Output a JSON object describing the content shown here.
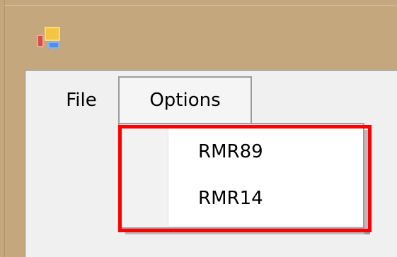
{
  "window": {
    "icon": "application-icon"
  },
  "menubar": {
    "items": [
      {
        "label": "File"
      },
      {
        "label": "Options"
      }
    ]
  },
  "dropdown": {
    "items": [
      {
        "label": "RMR89"
      },
      {
        "label": "RMR14"
      }
    ]
  },
  "annotation": {
    "highlight_color": "#ff0000"
  },
  "colors": {
    "desktop": "#c4a77c",
    "client_background": "#f0f0f0",
    "menu_background": "#ffffff",
    "menu_border": "#9c9c9c"
  }
}
